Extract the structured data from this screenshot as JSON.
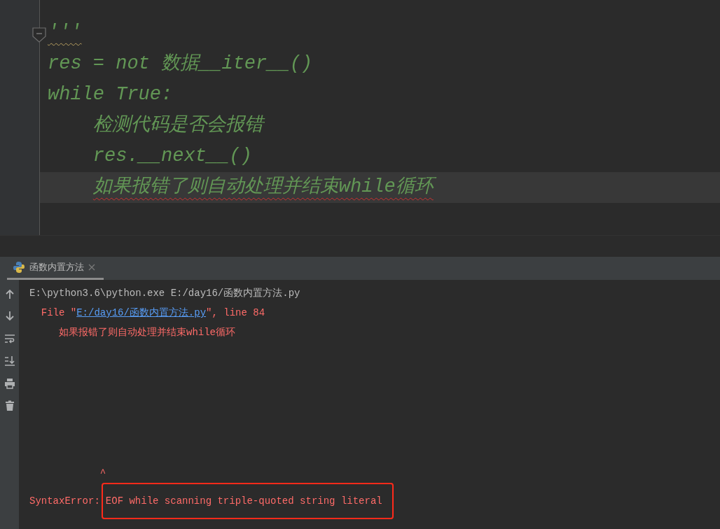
{
  "editor": {
    "lines": [
      {
        "text": "'''",
        "current": false,
        "warning": true,
        "error": false,
        "fold": true
      },
      {
        "text": "res = not 数据__iter__()",
        "current": false,
        "warning": false,
        "error": false,
        "fold": false
      },
      {
        "text": "while True:",
        "current": false,
        "warning": false,
        "error": false,
        "fold": false,
        "children": [
          {
            "text": "检测代码是否会报错",
            "current": false,
            "warning": false,
            "error": false,
            "fold": false
          },
          {
            "text": "res.__next__()",
            "current": false,
            "warning": false,
            "error": false,
            "fold": false
          },
          {
            "text": "如果报错了则自动处理并结束while循环",
            "current": true,
            "warning": false,
            "error": true,
            "fold": false
          }
        ]
      }
    ]
  },
  "run_panel": {
    "tabs": [
      {
        "label": "函数内置方法",
        "selected": true
      }
    ],
    "console": {
      "top_lines": [
        [
          {
            "text": "E:\\python3.6\\python.exe E:/day16/函数内置方法.py",
            "kind": "plain"
          }
        ],
        [
          {
            "text": "  File \"",
            "kind": "error"
          },
          {
            "text": "E:/day16/函数内置方法.py",
            "kind": "link"
          },
          {
            "text": "\", line 84",
            "kind": "error"
          }
        ],
        [
          {
            "text": "     如果报错了则自动处理并结束while循环",
            "kind": "error"
          }
        ]
      ],
      "bottom_lines": [
        [
          {
            "text": "            ^",
            "kind": "error"
          }
        ],
        [
          {
            "text": "SyntaxError:",
            "kind": "error"
          },
          {
            "text": "EOF while scanning triple-quoted string literal",
            "kind": "error",
            "boxed": true
          }
        ]
      ]
    }
  }
}
